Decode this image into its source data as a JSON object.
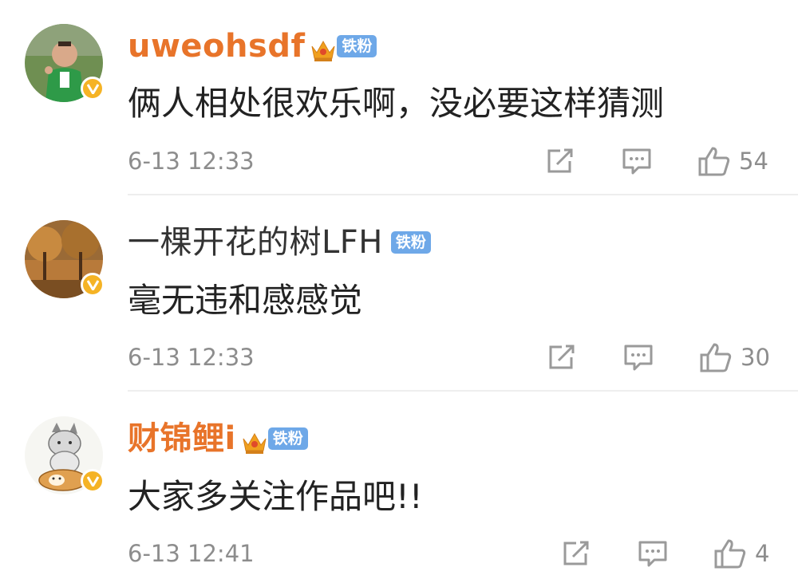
{
  "comments": [
    {
      "username": "uweohsdf",
      "name_color": "#e8742a",
      "crown": true,
      "fan_badge": "铁粉",
      "text": "俩人相处很欢乐啊，没必要这样猜测",
      "time": "6-13 12:33",
      "likes": "54",
      "avatar_icon": "child-photo-avatar"
    },
    {
      "username": "一棵开花的树LFH",
      "name_color": "#333333",
      "crown": false,
      "fan_badge": "铁粉",
      "text": "毫无违和感感觉",
      "time": "6-13 12:33",
      "likes": "30",
      "avatar_icon": "autumn-tree-avatar"
    },
    {
      "username": "财锦鲤i",
      "name_color": "#e8742a",
      "crown": true,
      "fan_badge": "铁粉",
      "text": "大家多关注作品吧!!",
      "time": "6-13 12:41",
      "likes": "4",
      "avatar_icon": "cat-dog-avatar"
    }
  ],
  "colors": {
    "vip_orange": "#e8742a",
    "fan_badge_blue": "#6ea8e8",
    "verified_gold": "#f5b325",
    "meta_gray": "#8d8d8d"
  }
}
